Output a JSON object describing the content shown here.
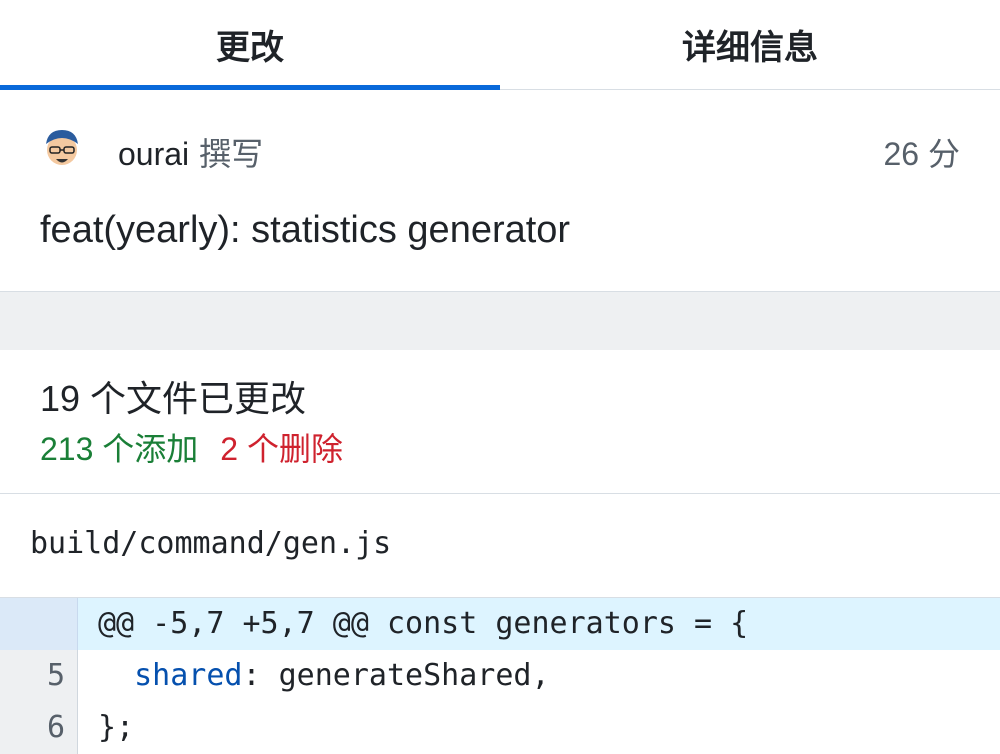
{
  "tabs": [
    {
      "label": "更改",
      "active": true
    },
    {
      "label": "详细信息",
      "active": false
    }
  ],
  "commit": {
    "avatar_icon": "user-avatar-icon",
    "author": "ourai",
    "author_verb": "撰写",
    "time": "26 分",
    "message": "feat(yearly): statistics generator"
  },
  "summary": {
    "files_changed": "19 个文件已更改",
    "additions": "213 个添加",
    "deletions": "2 个删除"
  },
  "file": {
    "path": "build/command/gen.js"
  },
  "diff": {
    "hunk_header": "@@ -5,7 +5,7 @@ const generators = {",
    "lines": [
      {
        "number": "5",
        "indent": "  ",
        "key": "shared",
        "rest": ": generateShared,"
      },
      {
        "number": "6",
        "indent": "",
        "key": "",
        "rest": "};"
      }
    ]
  },
  "colors": {
    "accent": "#0969da",
    "additions": "#1a7f37",
    "deletions": "#cf222e",
    "hunk_background": "#ddf4ff"
  }
}
